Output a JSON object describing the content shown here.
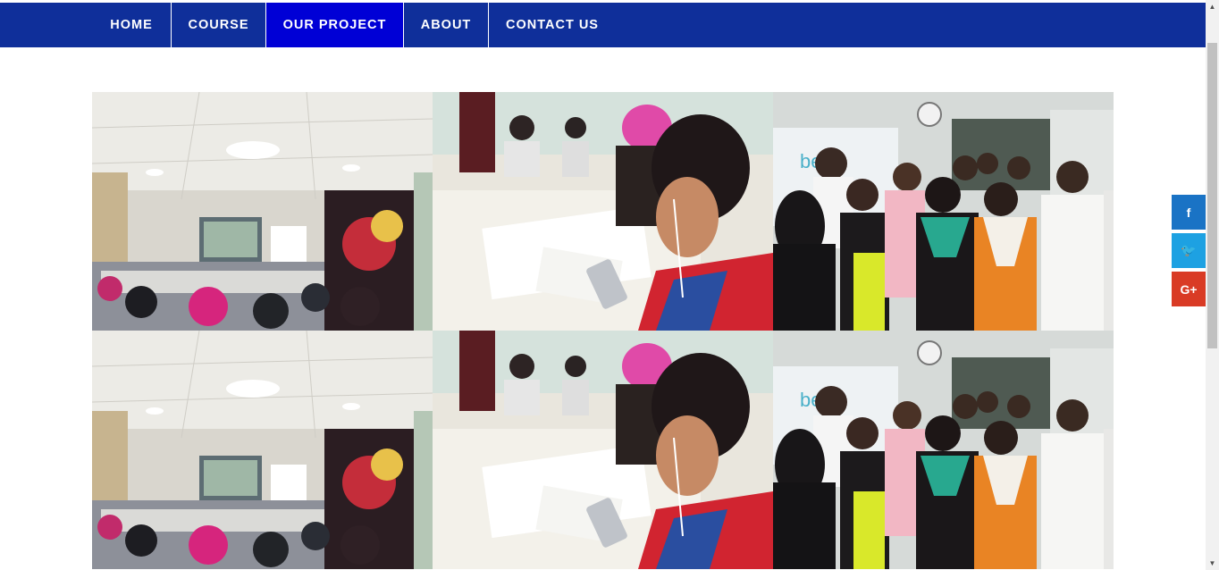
{
  "nav": {
    "items": [
      {
        "label": "HOME",
        "active": false
      },
      {
        "label": "COURSE",
        "active": false
      },
      {
        "label": "OUR PROJECT",
        "active": true
      },
      {
        "label": "ABOUT",
        "active": false
      },
      {
        "label": "CONTACT US",
        "active": false
      }
    ],
    "bg_color": "#0f2f9a",
    "active_color": "#0000d6"
  },
  "gallery": {
    "photos": [
      {
        "scene": "classroom-lecture"
      },
      {
        "scene": "student-with-phone"
      },
      {
        "scene": "group-photo"
      },
      {
        "scene": "classroom-lecture"
      },
      {
        "scene": "student-with-phone"
      },
      {
        "scene": "group-photo"
      }
    ]
  },
  "social": {
    "facebook": {
      "icon": "facebook-icon",
      "glyph": "f",
      "color": "#1a73c5"
    },
    "twitter": {
      "icon": "twitter-icon",
      "glyph": "🐦",
      "color": "#1da1e2"
    },
    "google_plus": {
      "icon": "google-plus-icon",
      "glyph": "G+",
      "color": "#d93b25"
    }
  }
}
